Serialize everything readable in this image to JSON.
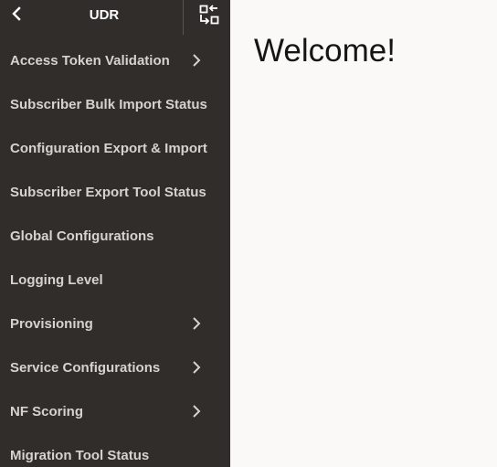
{
  "header": {
    "title": "UDR",
    "back_icon": "chevron-left-icon",
    "switch_icon": "switch-view-icon"
  },
  "nav": {
    "items": [
      {
        "label": "Access Token Validation",
        "has_submenu": true
      },
      {
        "label": "Subscriber Bulk Import Status",
        "has_submenu": false
      },
      {
        "label": "Configuration Export & Import",
        "has_submenu": false
      },
      {
        "label": "Subscriber Export Tool Status",
        "has_submenu": false
      },
      {
        "label": "Global Configurations",
        "has_submenu": false
      },
      {
        "label": "Logging Level",
        "has_submenu": false
      },
      {
        "label": "Provisioning",
        "has_submenu": true
      },
      {
        "label": "Service Configurations",
        "has_submenu": true
      },
      {
        "label": "NF Scoring",
        "has_submenu": true
      },
      {
        "label": "Migration Tool Status",
        "has_submenu": false
      }
    ]
  },
  "main": {
    "welcome": "Welcome!"
  },
  "colors": {
    "sidebar_bg": "#312d2a",
    "main_bg": "#faf9f8",
    "nav_text": "#d6d2cf",
    "welcome_text": "#161513"
  }
}
